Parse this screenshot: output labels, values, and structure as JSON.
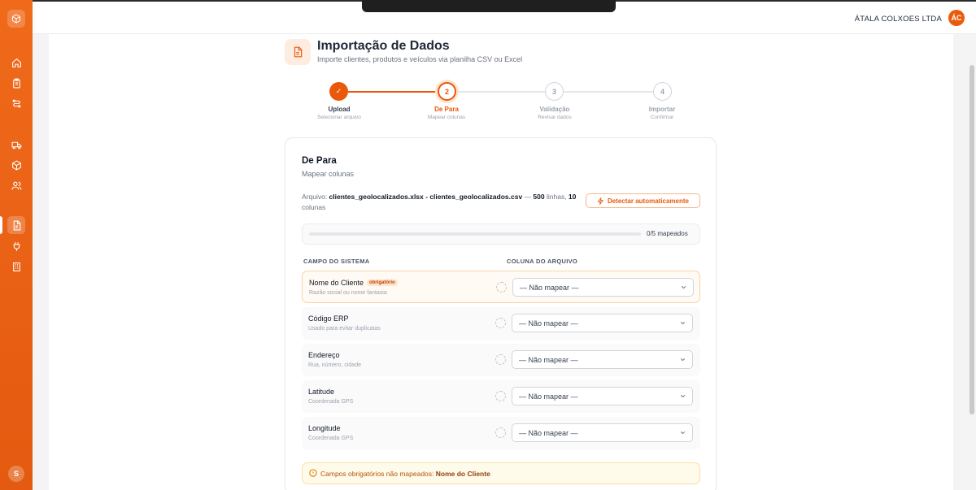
{
  "header": {
    "company": "ÁTALA COLXOES LTDA",
    "user_initials": "ÁC"
  },
  "sidebar": {
    "items": [
      {
        "icon": "home-icon"
      },
      {
        "icon": "clipboard-icon"
      },
      {
        "icon": "route-icon"
      },
      {
        "icon": "truck-icon"
      },
      {
        "icon": "box-icon"
      },
      {
        "icon": "users-icon"
      },
      {
        "icon": "file-import-icon",
        "active": true
      },
      {
        "icon": "plug-icon"
      },
      {
        "icon": "building-icon"
      }
    ],
    "user_initial": "S"
  },
  "page": {
    "title": "Importação de Dados",
    "subtitle": "Importe clientes, produtos e veículos via planilha CSV ou Excel"
  },
  "stepper": {
    "steps": [
      {
        "number": "✓",
        "label": "Upload",
        "sub": "Selecionar arquivo",
        "state": "done"
      },
      {
        "number": "2",
        "label": "De Para",
        "sub": "Mapear colunas",
        "state": "active"
      },
      {
        "number": "3",
        "label": "Validação",
        "sub": "Revisar dados",
        "state": "pending"
      },
      {
        "number": "4",
        "label": "Importar",
        "sub": "Confirmar",
        "state": "pending"
      }
    ]
  },
  "card": {
    "title": "De Para",
    "subtitle": "Mapear colunas",
    "file_prefix": "Arquivo: ",
    "file_name": "clientes_geolocalizados.xlsx - clientes_geolocalizados.csv",
    "file_dash": " — ",
    "rows_count": "500",
    "rows_word": "linhas, ",
    "cols_count": "10",
    "cols_word": " colunas",
    "detect_label": "Detectar automaticamente",
    "progress_text": "0/5 mapeados",
    "progress_fraction": 0,
    "col_system": "CAMPO DO SISTEMA",
    "col_file": "COLUNA DO ARQUIVO",
    "fields": [
      {
        "name": "Nome do Cliente",
        "badge": "obrigatório",
        "desc": "Razão social ou nome fantasia",
        "value": "— Não mapear —"
      },
      {
        "name": "Código ERP",
        "badge": "",
        "desc": "Usado para evitar duplicatas",
        "value": "— Não mapear —"
      },
      {
        "name": "Endereço",
        "badge": "",
        "desc": "Rua, número, cidade",
        "value": "— Não mapear —"
      },
      {
        "name": "Latitude",
        "badge": "",
        "desc": "Coordenada GPS",
        "value": "— Não mapear —"
      },
      {
        "name": "Longitude",
        "badge": "",
        "desc": "Coordenada GPS",
        "value": "— Não mapear —"
      }
    ],
    "warning_text": "Campos obrigatórios não mapeados: ",
    "warning_field": "Nome do Cliente"
  },
  "colors": {
    "accent": "#ea580c",
    "sidebar": "#f06a1b"
  }
}
